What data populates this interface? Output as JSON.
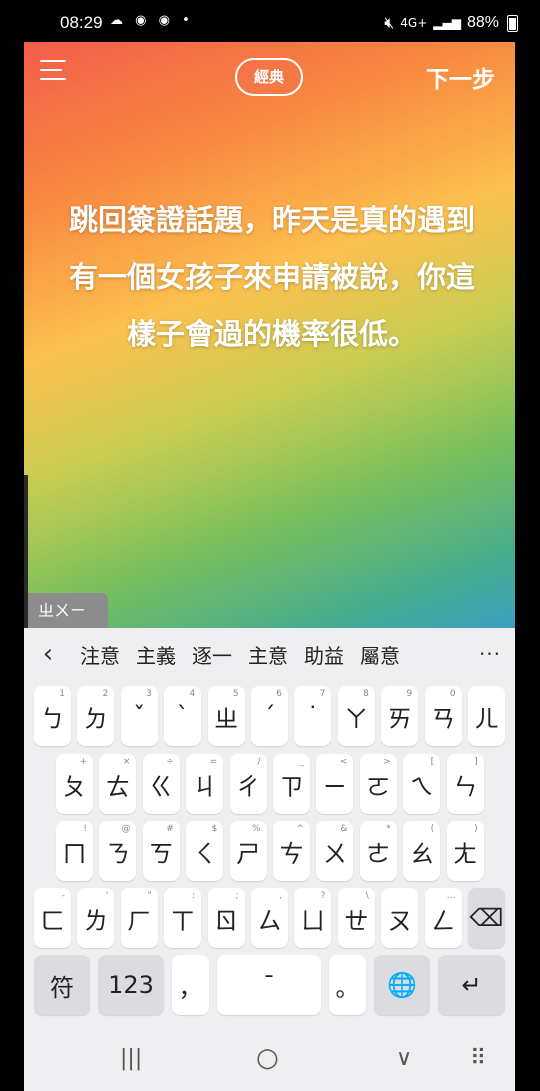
{
  "status": {
    "time": "08:29",
    "left_icons": "☁ ◉ ◉ •",
    "network": "4G+",
    "battery": "88%"
  },
  "header": {
    "menu_icon": "menu-icon",
    "style_label": "經典",
    "next_label": "下一步"
  },
  "post": {
    "text": "跳回簽證話題，昨天是真的遇到有一個女孩子來申請被說，你這樣子會過的機率很低。"
  },
  "compose": {
    "text": "ㄓㄨㄧ"
  },
  "suggestions": {
    "back": "‹",
    "items": [
      "注意",
      "主義",
      "逐一",
      "主意",
      "助益",
      "屬意"
    ],
    "more": "···"
  },
  "keyboard": {
    "row1": [
      {
        "k": "ㄅ",
        "h": "1"
      },
      {
        "k": "ㄉ",
        "h": "2"
      },
      {
        "k": "ˇ",
        "h": "3"
      },
      {
        "k": "ˋ",
        "h": "4"
      },
      {
        "k": "ㄓ",
        "h": "5"
      },
      {
        "k": "ˊ",
        "h": "6"
      },
      {
        "k": "˙",
        "h": "7"
      },
      {
        "k": "ㄚ",
        "h": "8"
      },
      {
        "k": "ㄞ",
        "h": "9"
      },
      {
        "k": "ㄢ",
        "h": "0"
      },
      {
        "k": "ㄦ",
        "h": ""
      }
    ],
    "row2": [
      {
        "k": "ㄆ",
        "h": "+"
      },
      {
        "k": "ㄊ",
        "h": "×"
      },
      {
        "k": "ㄍ",
        "h": "÷"
      },
      {
        "k": "ㄐ",
        "h": "="
      },
      {
        "k": "ㄔ",
        "h": "/"
      },
      {
        "k": "ㄗ",
        "h": "_"
      },
      {
        "k": "ㄧ",
        "h": "<"
      },
      {
        "k": "ㄛ",
        "h": ">"
      },
      {
        "k": "ㄟ",
        "h": "["
      },
      {
        "k": "ㄣ",
        "h": "]"
      }
    ],
    "row3": [
      {
        "k": "ㄇ",
        "h": "!"
      },
      {
        "k": "ㄋ",
        "h": "@"
      },
      {
        "k": "ㄎ",
        "h": "#"
      },
      {
        "k": "ㄑ",
        "h": "$"
      },
      {
        "k": "ㄕ",
        "h": "%"
      },
      {
        "k": "ㄘ",
        "h": "^"
      },
      {
        "k": "ㄨ",
        "h": "&"
      },
      {
        "k": "ㄜ",
        "h": "*"
      },
      {
        "k": "ㄠ",
        "h": "("
      },
      {
        "k": "ㄤ",
        "h": ")"
      }
    ],
    "row4": [
      {
        "k": "ㄈ",
        "h": "-"
      },
      {
        "k": "ㄌ",
        "h": "'"
      },
      {
        "k": "ㄏ",
        "h": "\""
      },
      {
        "k": "ㄒ",
        "h": ":"
      },
      {
        "k": "ㄖ",
        "h": ";"
      },
      {
        "k": "ㄙ",
        "h": ","
      },
      {
        "k": "ㄩ",
        "h": "?"
      },
      {
        "k": "ㄝ",
        "h": "\\"
      },
      {
        "k": "ㄡ",
        "h": ""
      },
      {
        "k": "ㄥ",
        "h": "…"
      }
    ],
    "backspace": "⌫",
    "bottom": {
      "symbols": "符",
      "numbers": "123",
      "comma": "，",
      "space": "ˉ",
      "period": "。",
      "globe": "🌐",
      "enter": "↵"
    }
  },
  "nav": {
    "recent": "|||",
    "home": "○",
    "back": "∨",
    "keyboard": "⠿"
  }
}
